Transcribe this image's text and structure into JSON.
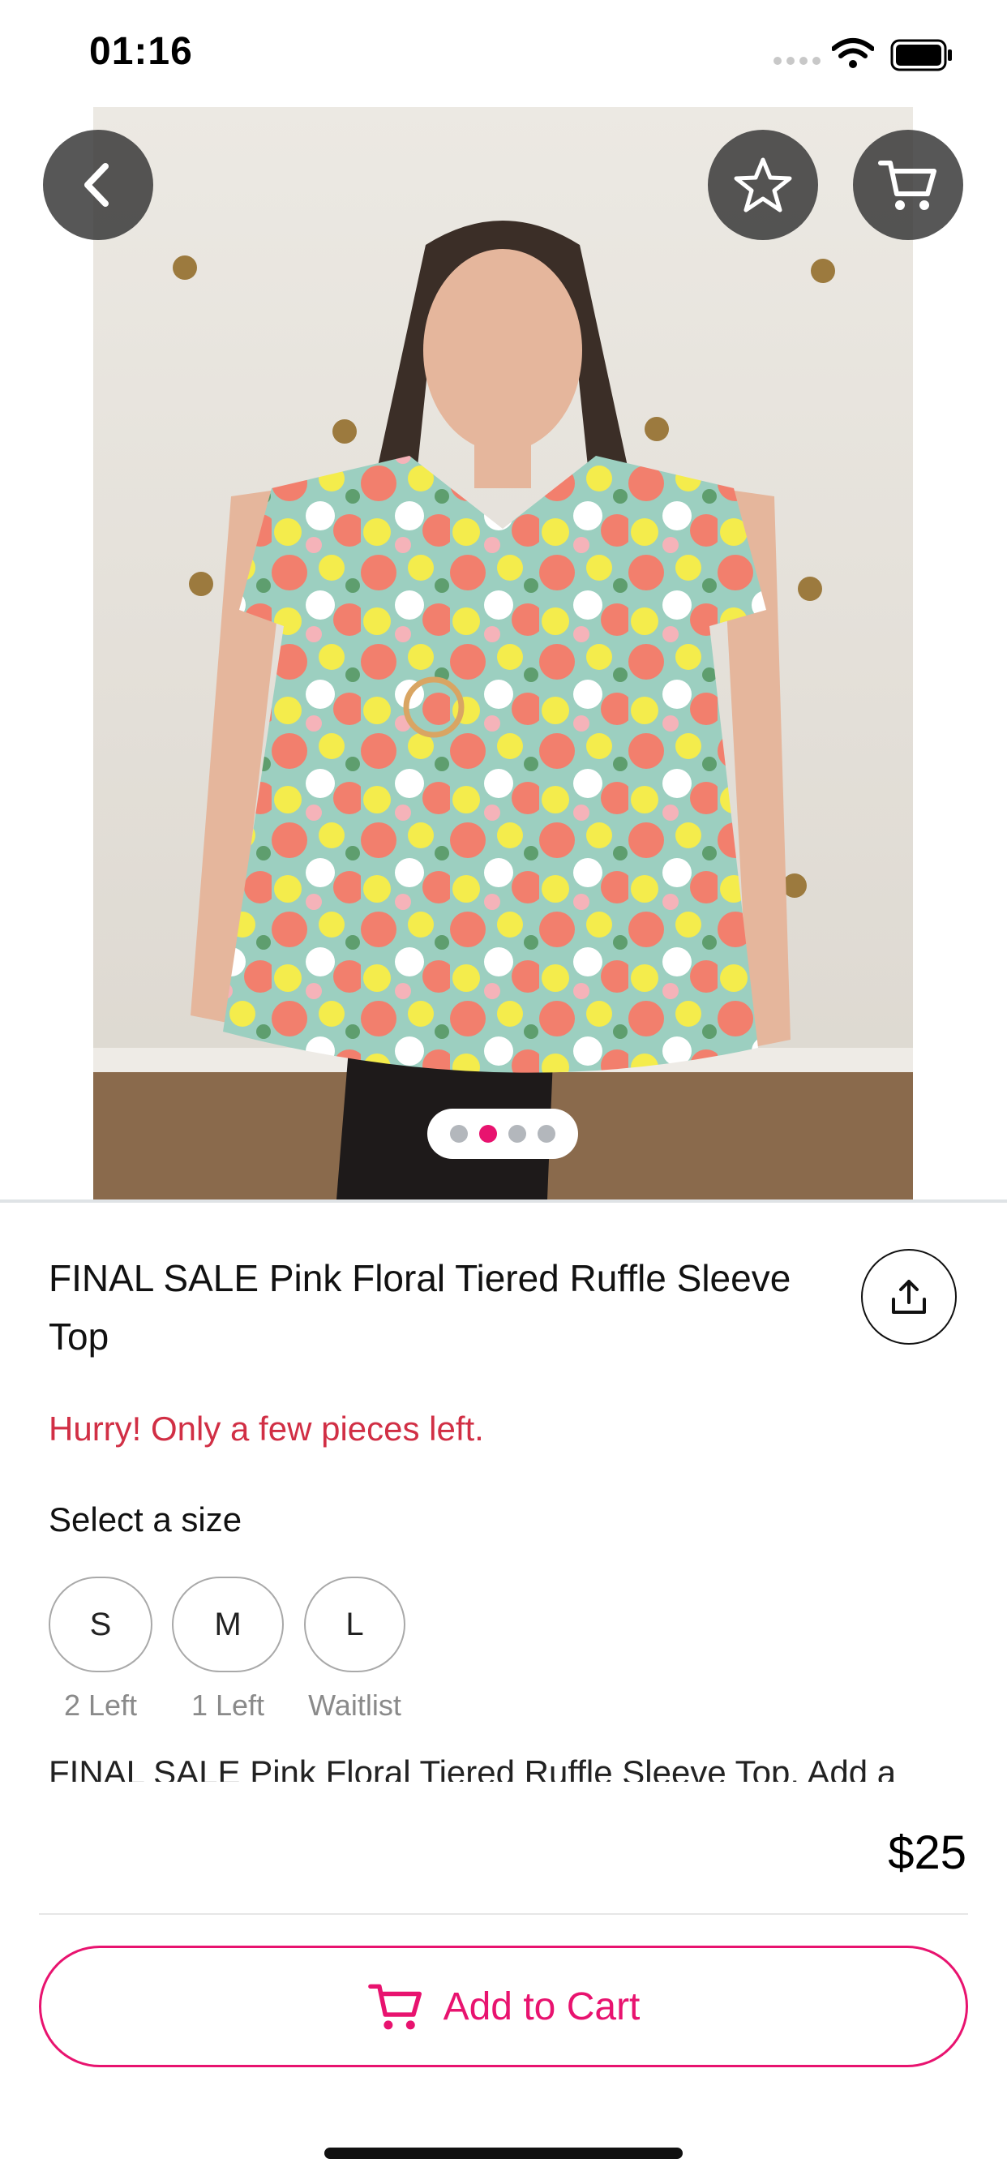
{
  "status_bar": {
    "time": "01:16"
  },
  "carousel": {
    "count": 4,
    "active_index": 1
  },
  "product": {
    "title": "FINAL SALE Pink Floral Tiered Ruffle Sleeve Top",
    "urgency": "Hurry! Only a few pieces left.",
    "size_label": "Select a size",
    "sizes": [
      {
        "label": "S",
        "stock": "2 Left"
      },
      {
        "label": "M",
        "stock": "1 Left"
      },
      {
        "label": "L",
        "stock": "Waitlist"
      }
    ],
    "description": "FINAL SALE Pink Floral Tiered Ruffle Sleeve Top. Add a"
  },
  "purchase": {
    "price": "$25",
    "add_to_cart_label": "Add to Cart"
  },
  "colors": {
    "accent": "#e8136f",
    "urgency": "#d12f45"
  },
  "icons": {
    "back": "chevron-left-icon",
    "favorite": "star-icon",
    "cart": "cart-icon",
    "share": "share-icon"
  }
}
